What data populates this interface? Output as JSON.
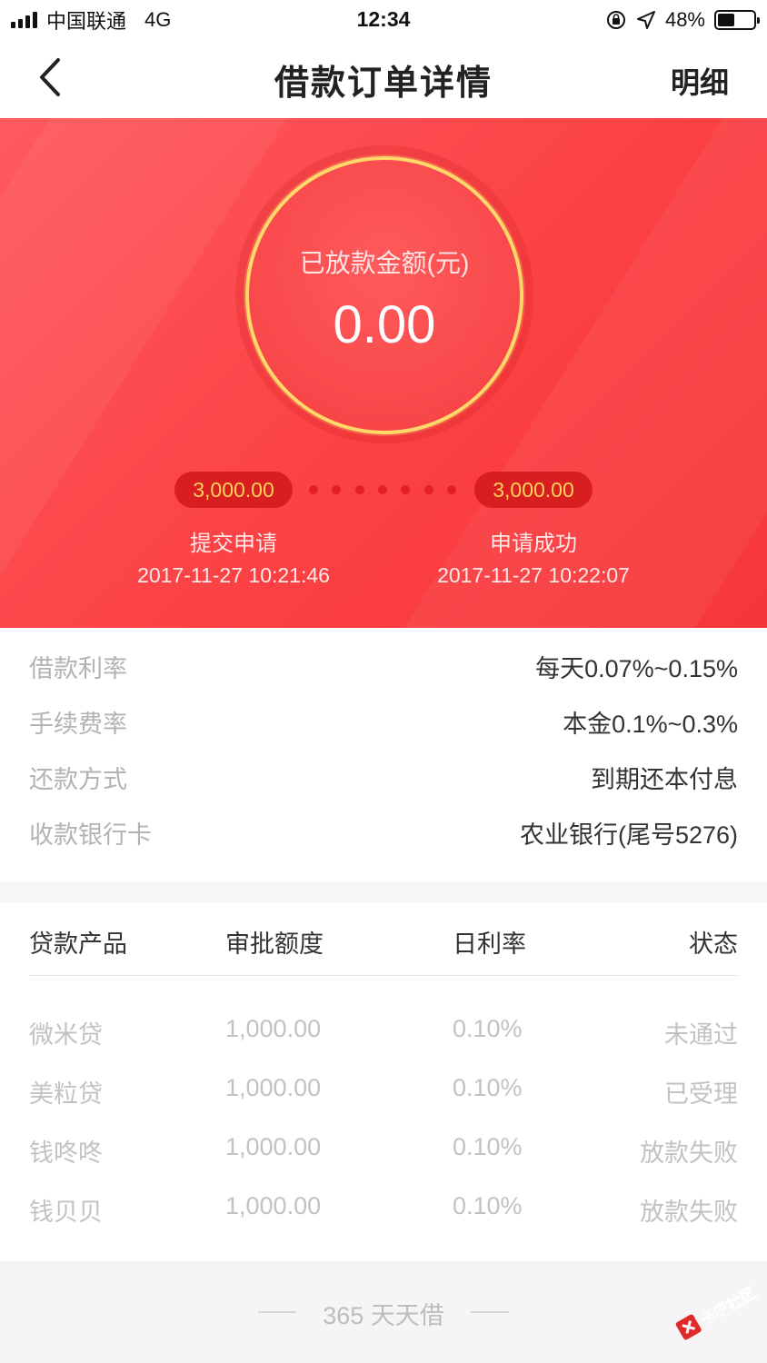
{
  "status_bar": {
    "carrier": "中国联通",
    "network": "4G",
    "time": "12:34",
    "battery": "48%",
    "battery_level": 0.48
  },
  "nav": {
    "title": "借款订单详情",
    "right_label": "明细"
  },
  "hero": {
    "label": "已放款金额(元)",
    "amount": "0.00",
    "steps": [
      {
        "amount": "3,000.00",
        "label": "提交申请",
        "time": "2017-11-27 10:21:46"
      },
      {
        "amount": "3,000.00",
        "label": "申请成功",
        "time": "2017-11-27 10:22:07"
      }
    ]
  },
  "info": [
    {
      "label": "借款利率",
      "value": "每天0.07%~0.15%"
    },
    {
      "label": "手续费率",
      "value": "本金0.1%~0.3%"
    },
    {
      "label": "还款方式",
      "value": "到期还本付息"
    },
    {
      "label": "收款银行卡",
      "value": "农业银行(尾号5276)"
    }
  ],
  "table": {
    "headers": [
      "贷款产品",
      "审批额度",
      "日利率",
      "状态"
    ],
    "rows": [
      [
        "微米贷",
        "1,000.00",
        "0.10%",
        "未通过"
      ],
      [
        "美粒贷",
        "1,000.00",
        "0.10%",
        "已受理"
      ],
      [
        "钱咚咚",
        "1,000.00",
        "0.10%",
        "放款失败"
      ],
      [
        "钱贝贝",
        "1,000.00",
        "0.10%",
        "放款失败"
      ]
    ]
  },
  "footer": {
    "text": "365 天天借"
  },
  "watermark": {
    "text": "卡农社区"
  },
  "colors": {
    "hero_red": "#fb4144",
    "ring_gold": "#ffd86a",
    "pill_bg": "#d81e1e",
    "pill_text": "#ffd35a"
  }
}
